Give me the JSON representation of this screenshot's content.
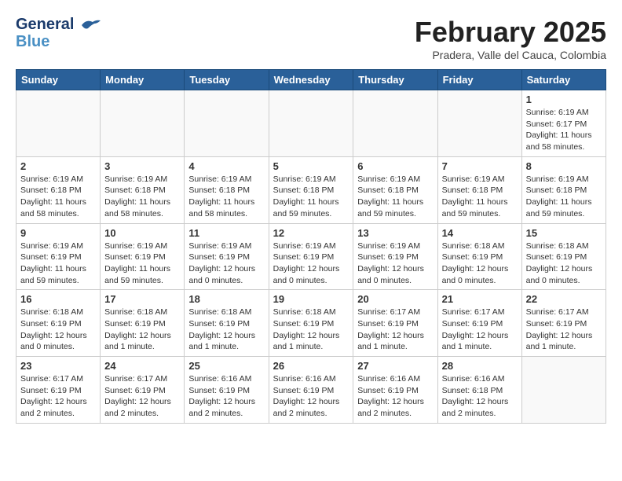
{
  "header": {
    "logo_line1": "General",
    "logo_line2": "Blue",
    "month_year": "February 2025",
    "location": "Pradera, Valle del Cauca, Colombia"
  },
  "weekdays": [
    "Sunday",
    "Monday",
    "Tuesday",
    "Wednesday",
    "Thursday",
    "Friday",
    "Saturday"
  ],
  "weeks": [
    [
      {
        "day": "",
        "info": ""
      },
      {
        "day": "",
        "info": ""
      },
      {
        "day": "",
        "info": ""
      },
      {
        "day": "",
        "info": ""
      },
      {
        "day": "",
        "info": ""
      },
      {
        "day": "",
        "info": ""
      },
      {
        "day": "1",
        "info": "Sunrise: 6:19 AM\nSunset: 6:17 PM\nDaylight: 11 hours\nand 58 minutes."
      }
    ],
    [
      {
        "day": "2",
        "info": "Sunrise: 6:19 AM\nSunset: 6:18 PM\nDaylight: 11 hours\nand 58 minutes."
      },
      {
        "day": "3",
        "info": "Sunrise: 6:19 AM\nSunset: 6:18 PM\nDaylight: 11 hours\nand 58 minutes."
      },
      {
        "day": "4",
        "info": "Sunrise: 6:19 AM\nSunset: 6:18 PM\nDaylight: 11 hours\nand 58 minutes."
      },
      {
        "day": "5",
        "info": "Sunrise: 6:19 AM\nSunset: 6:18 PM\nDaylight: 11 hours\nand 59 minutes."
      },
      {
        "day": "6",
        "info": "Sunrise: 6:19 AM\nSunset: 6:18 PM\nDaylight: 11 hours\nand 59 minutes."
      },
      {
        "day": "7",
        "info": "Sunrise: 6:19 AM\nSunset: 6:18 PM\nDaylight: 11 hours\nand 59 minutes."
      },
      {
        "day": "8",
        "info": "Sunrise: 6:19 AM\nSunset: 6:18 PM\nDaylight: 11 hours\nand 59 minutes."
      }
    ],
    [
      {
        "day": "9",
        "info": "Sunrise: 6:19 AM\nSunset: 6:19 PM\nDaylight: 11 hours\nand 59 minutes."
      },
      {
        "day": "10",
        "info": "Sunrise: 6:19 AM\nSunset: 6:19 PM\nDaylight: 11 hours\nand 59 minutes."
      },
      {
        "day": "11",
        "info": "Sunrise: 6:19 AM\nSunset: 6:19 PM\nDaylight: 12 hours\nand 0 minutes."
      },
      {
        "day": "12",
        "info": "Sunrise: 6:19 AM\nSunset: 6:19 PM\nDaylight: 12 hours\nand 0 minutes."
      },
      {
        "day": "13",
        "info": "Sunrise: 6:19 AM\nSunset: 6:19 PM\nDaylight: 12 hours\nand 0 minutes."
      },
      {
        "day": "14",
        "info": "Sunrise: 6:18 AM\nSunset: 6:19 PM\nDaylight: 12 hours\nand 0 minutes."
      },
      {
        "day": "15",
        "info": "Sunrise: 6:18 AM\nSunset: 6:19 PM\nDaylight: 12 hours\nand 0 minutes."
      }
    ],
    [
      {
        "day": "16",
        "info": "Sunrise: 6:18 AM\nSunset: 6:19 PM\nDaylight: 12 hours\nand 0 minutes."
      },
      {
        "day": "17",
        "info": "Sunrise: 6:18 AM\nSunset: 6:19 PM\nDaylight: 12 hours\nand 1 minute."
      },
      {
        "day": "18",
        "info": "Sunrise: 6:18 AM\nSunset: 6:19 PM\nDaylight: 12 hours\nand 1 minute."
      },
      {
        "day": "19",
        "info": "Sunrise: 6:18 AM\nSunset: 6:19 PM\nDaylight: 12 hours\nand 1 minute."
      },
      {
        "day": "20",
        "info": "Sunrise: 6:17 AM\nSunset: 6:19 PM\nDaylight: 12 hours\nand 1 minute."
      },
      {
        "day": "21",
        "info": "Sunrise: 6:17 AM\nSunset: 6:19 PM\nDaylight: 12 hours\nand 1 minute."
      },
      {
        "day": "22",
        "info": "Sunrise: 6:17 AM\nSunset: 6:19 PM\nDaylight: 12 hours\nand 1 minute."
      }
    ],
    [
      {
        "day": "23",
        "info": "Sunrise: 6:17 AM\nSunset: 6:19 PM\nDaylight: 12 hours\nand 2 minutes."
      },
      {
        "day": "24",
        "info": "Sunrise: 6:17 AM\nSunset: 6:19 PM\nDaylight: 12 hours\nand 2 minutes."
      },
      {
        "day": "25",
        "info": "Sunrise: 6:16 AM\nSunset: 6:19 PM\nDaylight: 12 hours\nand 2 minutes."
      },
      {
        "day": "26",
        "info": "Sunrise: 6:16 AM\nSunset: 6:19 PM\nDaylight: 12 hours\nand 2 minutes."
      },
      {
        "day": "27",
        "info": "Sunrise: 6:16 AM\nSunset: 6:19 PM\nDaylight: 12 hours\nand 2 minutes."
      },
      {
        "day": "28",
        "info": "Sunrise: 6:16 AM\nSunset: 6:18 PM\nDaylight: 12 hours\nand 2 minutes."
      },
      {
        "day": "",
        "info": ""
      }
    ]
  ]
}
